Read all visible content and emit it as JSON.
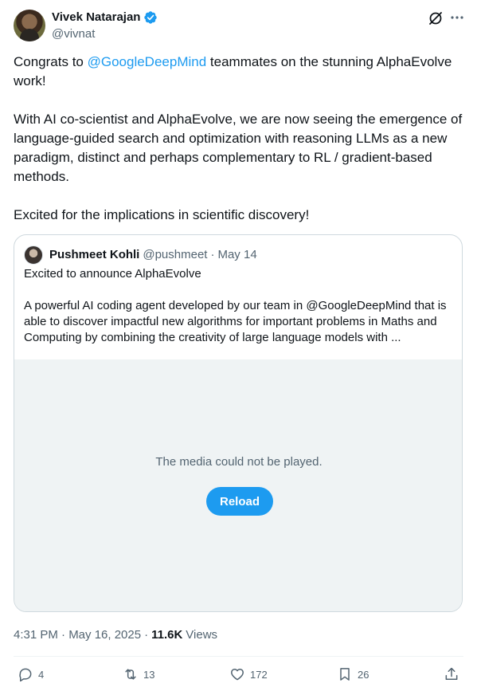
{
  "author": {
    "name": "Vivek Natarajan",
    "handle": "@vivnat"
  },
  "tweet": {
    "line1_prefix": "Congrats to ",
    "line1_mention": "@GoogleDeepMind",
    "line1_suffix": " teammates on the stunning AlphaEvolve work!",
    "para2": "With AI co-scientist and AlphaEvolve, we are now seeing the emergence of language-guided search and optimization with reasoning LLMs as a new paradigm, distinct and perhaps complementary to RL / gradient-based methods.",
    "para3": "Excited for the implications in scientific discovery!"
  },
  "quote": {
    "name": "Pushmeet Kohli",
    "handle": "@pushmeet",
    "separator": "·",
    "date": "May 14",
    "text": "Excited to announce AlphaEvolve\n\nA powerful AI coding agent developed by our team in @GoogleDeepMind that is able to discover impactful new algorithms for important problems in Maths and Computing by combining the creativity of large language models with ..."
  },
  "media": {
    "message": "The media could not be played.",
    "reload_label": "Reload"
  },
  "meta": {
    "timestamp": "4:31 PM · May 16, 2025",
    "separator": "·",
    "views_count": "11.6K",
    "views_label": "Views"
  },
  "actions": {
    "replies": "4",
    "reposts": "13",
    "likes": "172",
    "bookmarks": "26"
  },
  "colors": {
    "accent": "#1d9bf0",
    "text": "#0f1419",
    "secondary": "#536471",
    "border": "#cfd9de",
    "media_bg": "#eff3f4"
  }
}
